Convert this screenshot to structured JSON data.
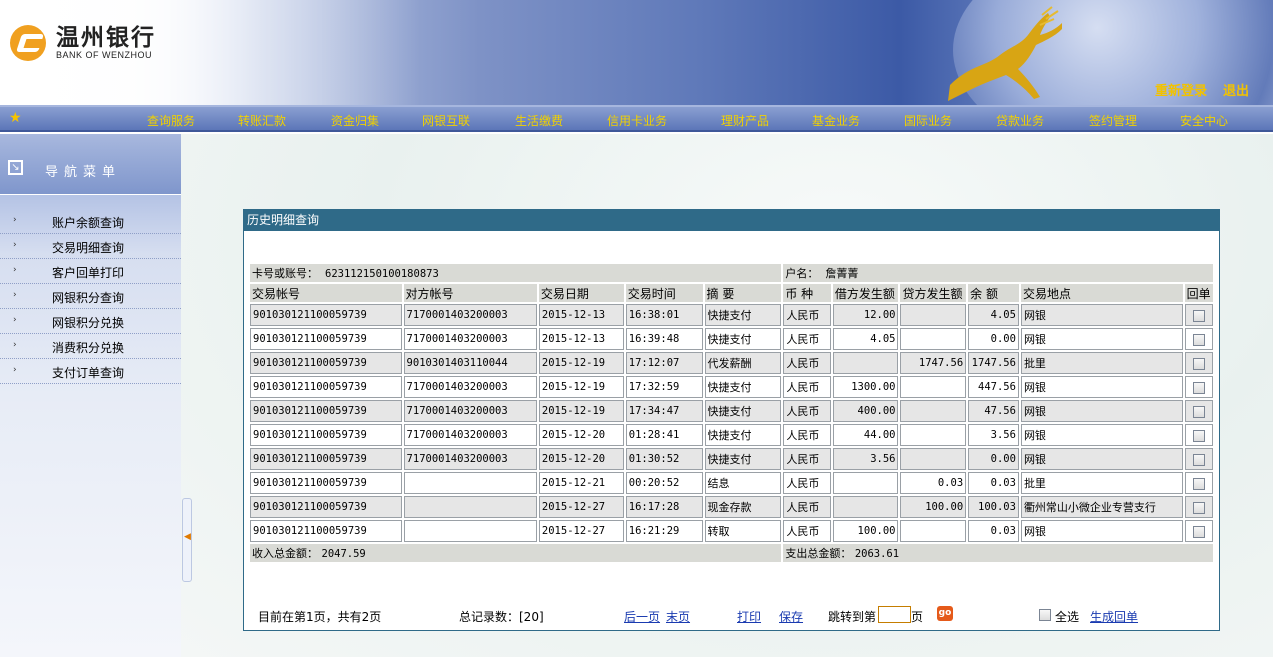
{
  "brand": {
    "name_cn": "温州银行",
    "name_en": "BANK OF WENZHOU"
  },
  "header": {
    "relogin": "重新登录",
    "logout": "退出"
  },
  "nav": [
    "查询服务",
    "转账汇款",
    "资金归集",
    "网银互联",
    "生活缴费",
    "信用卡业务",
    "理财产品",
    "基金业务",
    "国际业务",
    "贷款业务",
    "签约管理",
    "安全中心"
  ],
  "sidebar": {
    "title": "导航菜单",
    "items": [
      "账户余额查询",
      "交易明细查询",
      "客户回单打印",
      "网银积分查询",
      "网银积分兑换",
      "消费积分兑换",
      "支付订单查询"
    ]
  },
  "panel": {
    "title": "历史明细查询",
    "card_label": "卡号或账号：",
    "card_no": "623112150100180873",
    "owner_label": "户名：",
    "owner": "詹菁菁",
    "columns": [
      "交易帐号",
      "对方帐号",
      "交易日期",
      "交易时间",
      "摘 要",
      "币 种",
      "借方发生额",
      "贷方发生额",
      "余 额",
      "交易地点",
      "回单"
    ],
    "rows": [
      [
        "901030121100059739",
        "7170001403200003",
        "2015-12-13",
        "16:38:01",
        "快捷支付",
        "人民币",
        "12.00",
        "",
        "4.05",
        "网银"
      ],
      [
        "901030121100059739",
        "7170001403200003",
        "2015-12-13",
        "16:39:48",
        "快捷支付",
        "人民币",
        "4.05",
        "",
        "0.00",
        "网银"
      ],
      [
        "901030121100059739",
        "9010301403110044",
        "2015-12-19",
        "17:12:07",
        "代发薪酬",
        "人民币",
        "",
        "1747.56",
        "1747.56",
        "批里"
      ],
      [
        "901030121100059739",
        "7170001403200003",
        "2015-12-19",
        "17:32:59",
        "快捷支付",
        "人民币",
        "1300.00",
        "",
        "447.56",
        "网银"
      ],
      [
        "901030121100059739",
        "7170001403200003",
        "2015-12-19",
        "17:34:47",
        "快捷支付",
        "人民币",
        "400.00",
        "",
        "47.56",
        "网银"
      ],
      [
        "901030121100059739",
        "7170001403200003",
        "2015-12-20",
        "01:28:41",
        "快捷支付",
        "人民币",
        "44.00",
        "",
        "3.56",
        "网银"
      ],
      [
        "901030121100059739",
        "7170001403200003",
        "2015-12-20",
        "01:30:52",
        "快捷支付",
        "人民币",
        "3.56",
        "",
        "0.00",
        "网银"
      ],
      [
        "901030121100059739",
        "",
        "2015-12-21",
        "00:20:52",
        "结息",
        "人民币",
        "",
        "0.03",
        "0.03",
        "批里"
      ],
      [
        "901030121100059739",
        "",
        "2015-12-27",
        "16:17:28",
        "现金存款",
        "人民币",
        "",
        "100.00",
        "100.03",
        "衢州常山小微企业专营支行"
      ],
      [
        "901030121100059739",
        "",
        "2015-12-27",
        "16:21:29",
        "转取",
        "人民币",
        "100.00",
        "",
        "0.03",
        "网银"
      ]
    ],
    "income_label": "收入总金额：",
    "income_total": "2047.59",
    "expense_label": "支出总金额：",
    "expense_total": "2063.61"
  },
  "footer": {
    "page_info": "目前在第1页，共有2页",
    "total_records": "总记录数：[20]",
    "next_page": "后一页",
    "last_page": "末页",
    "print": "打印",
    "save": "保存",
    "jump_prefix": "跳转到第",
    "jump_suffix": "页",
    "go": "go",
    "select_all": "全选",
    "generate_receipt": "生成回单"
  }
}
